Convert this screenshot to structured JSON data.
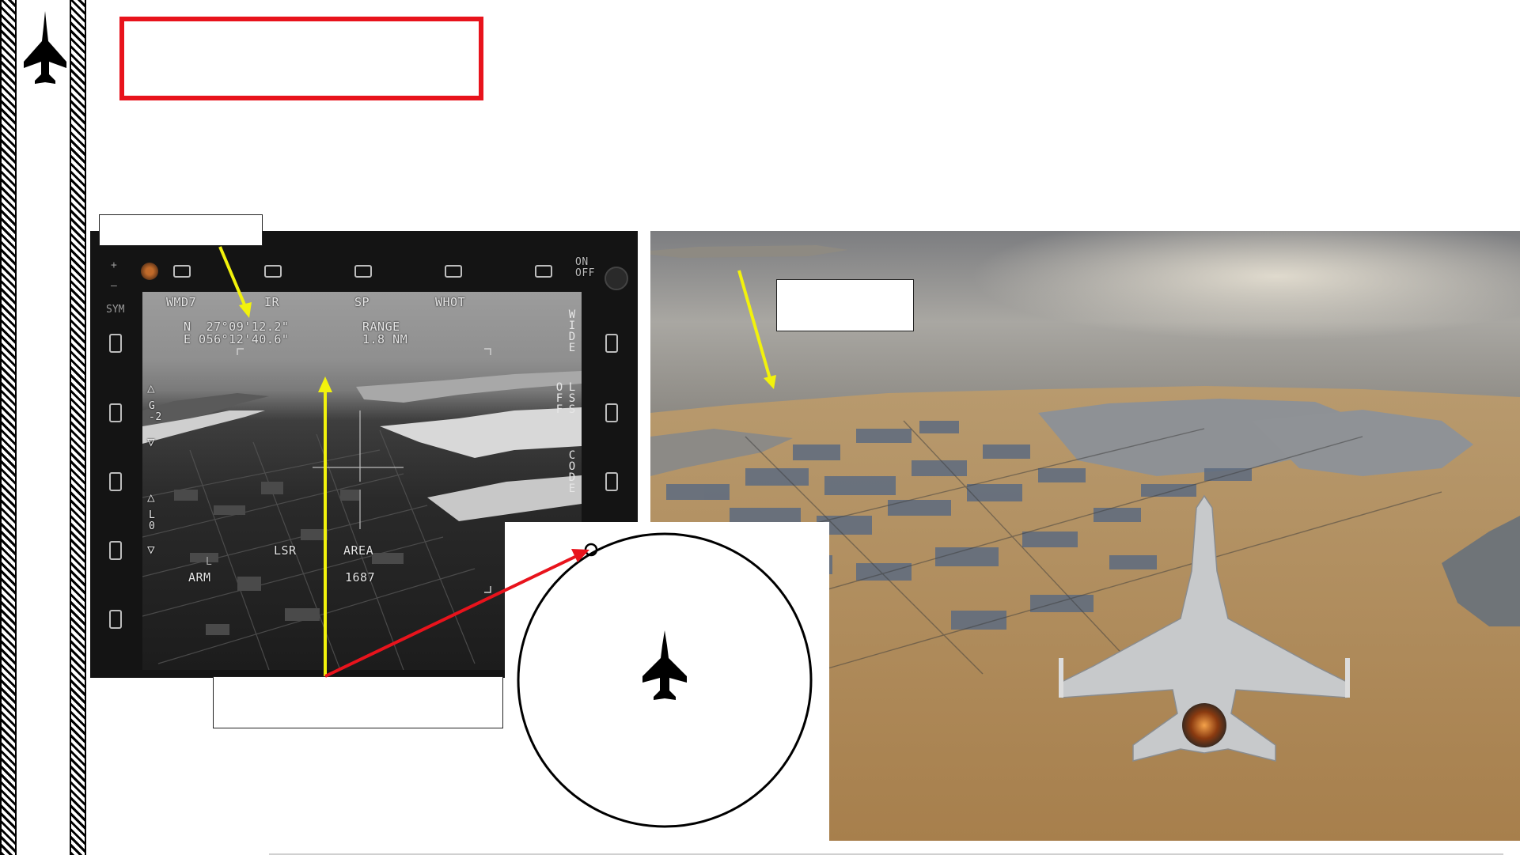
{
  "mfd": {
    "top_labels": [
      "WMD7",
      "IR",
      "SP",
      "WHOT"
    ],
    "coord_north": "N  27°09'12.2\"",
    "coord_east": "E 056°12'40.6\"",
    "range_label": "RANGE",
    "range_value": "1.8 NM",
    "right_wide": "WIDE",
    "right_off": "OFF",
    "right_lss": "LSS",
    "right_code": "CODE",
    "on_off": "ON\nOFF",
    "sym": "SYM",
    "gain_label": "G\n-2",
    "level_label": "L\n0",
    "lsr": "LSR",
    "area": "AREA",
    "arm": "ARM",
    "code_value": "1687"
  },
  "colors": {
    "accent_red": "#e8131c",
    "arrow_yellow": "#f2f20c",
    "arrow_red": "#e8131c"
  },
  "icons": [
    "jet-silhouette-icon",
    "jet-silhouette-icon"
  ]
}
